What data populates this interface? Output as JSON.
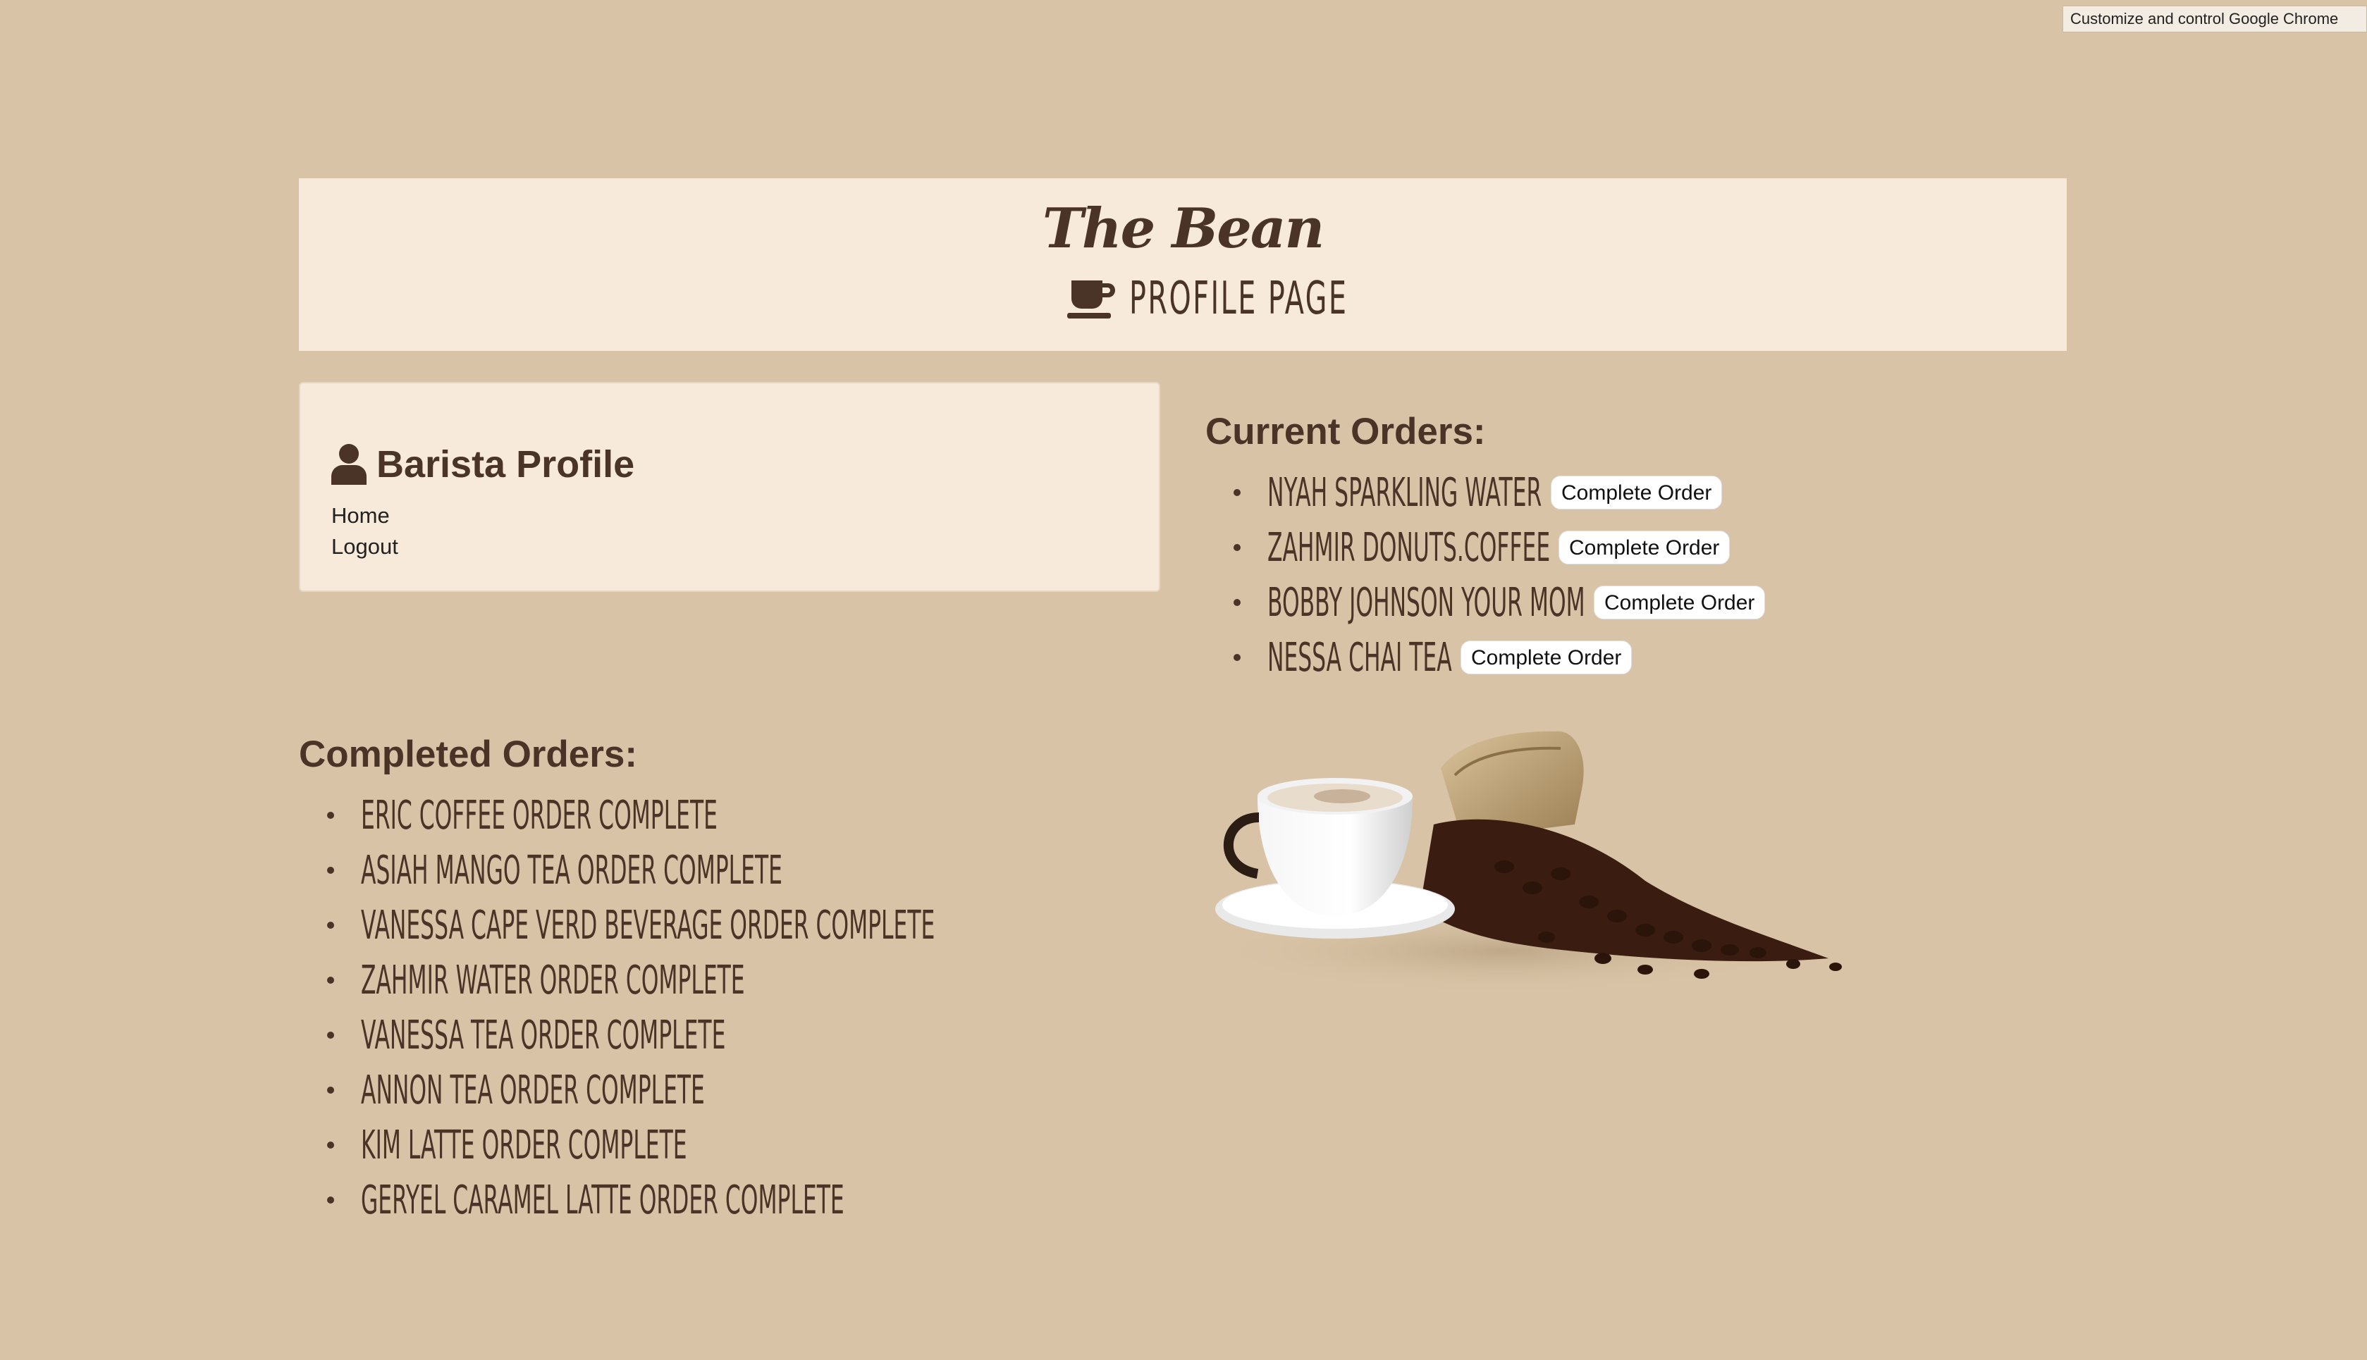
{
  "browser": {
    "tooltip": "Customize and control Google Chrome"
  },
  "header": {
    "brand": "The Bean",
    "subtitle": "PROFILE PAGE",
    "icon": "coffee-cup-icon"
  },
  "profile": {
    "icon": "user-icon",
    "title": "Barista Profile",
    "links": [
      "Home",
      "Logout"
    ]
  },
  "current_orders": {
    "title": "Current Orders:",
    "button_label": "Complete Order",
    "items": [
      "NYAH SPARKLING WATER",
      "ZAHMIR DONUTS.COFFEE",
      "BOBBY JOHNSON YOUR MOM",
      "NESSA CHAI TEA"
    ]
  },
  "completed_orders": {
    "title": "Completed Orders:",
    "items": [
      "ERIC COFFEE ORDER COMPLETE",
      "ASIAH MANGO TEA ORDER COMPLETE",
      "VANESSA CAPE VERD BEVERAGE ORDER COMPLETE",
      "ZAHMIR WATER ORDER COMPLETE",
      "VANESSA TEA ORDER COMPLETE",
      "ANNON TEA ORDER COMPLETE",
      "KIM LATTE ORDER COMPLETE",
      "GERYEL CARAMEL LATTE ORDER COMPLETE"
    ]
  },
  "image": {
    "icon": "coffee-cup-and-beans-image"
  },
  "colors": {
    "background": "#d8c3a6",
    "panel": "#f7eadb",
    "text": "#4a3428"
  }
}
